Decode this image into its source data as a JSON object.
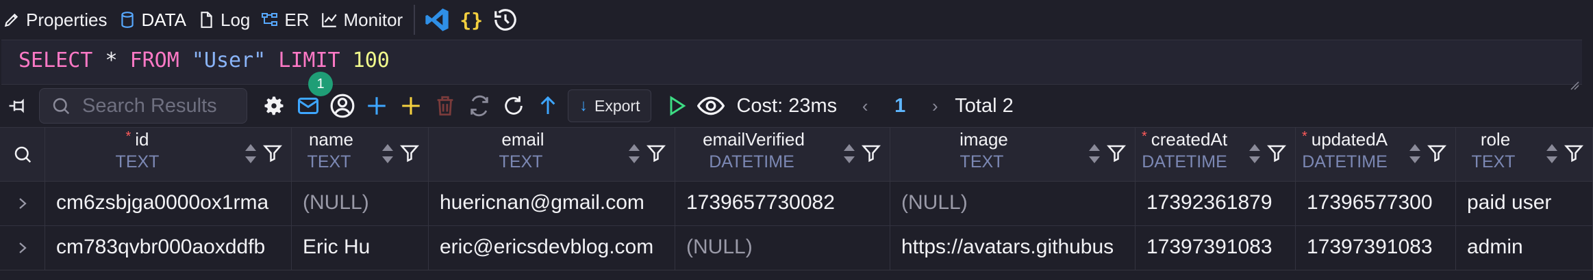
{
  "tabs": [
    {
      "label": "Properties",
      "icon": "pencil-icon"
    },
    {
      "label": "DATA",
      "icon": "database-icon",
      "active": true
    },
    {
      "label": "Log",
      "icon": "document-icon"
    },
    {
      "label": "ER",
      "icon": "er-diagram-icon"
    },
    {
      "label": "Monitor",
      "icon": "chart-line-icon"
    }
  ],
  "tools": {
    "braces": "{}"
  },
  "editor": {
    "tokens": {
      "kw1": "SELECT",
      "star": "*",
      "kw2": "FROM",
      "table": "\"User\"",
      "kw3": "LIMIT",
      "limit": "100"
    }
  },
  "toolbar": {
    "search_placeholder": "Search Results",
    "mail_badge": "1",
    "export_label": "Export",
    "cost": "Cost: 23ms",
    "page_prev": "‹",
    "page": "1",
    "page_next": "›",
    "total": "Total 2"
  },
  "colors": {
    "accent": "#57a9ff",
    "keyword": "#ff79c6",
    "string": "#8ab4f8",
    "number": "#f1fa8c",
    "required": "#ff5b5b",
    "type": "#7c88b4"
  },
  "columns": [
    {
      "name": "id",
      "type": "TEXT",
      "required": true
    },
    {
      "name": "name",
      "type": "TEXT",
      "required": false
    },
    {
      "name": "email",
      "type": "TEXT",
      "required": false
    },
    {
      "name": "emailVerified",
      "type": "DATETIME",
      "required": false
    },
    {
      "name": "image",
      "type": "TEXT",
      "required": false
    },
    {
      "name": "createdAt",
      "type": "DATETIME",
      "required": true
    },
    {
      "name": "updatedA",
      "type": "DATETIME",
      "required": true
    },
    {
      "name": "role",
      "type": "TEXT",
      "required": false
    }
  ],
  "rows": [
    [
      "cm6zsbjga0000ox1rma",
      "(NULL)",
      "huericnan@gmail.com",
      "1739657730082",
      "(NULL)",
      "17392361879",
      "17396577300",
      "paid user"
    ],
    [
      "cm783qvbr000aoxddfb",
      "Eric Hu",
      "eric@ericsdevblog.com",
      "(NULL)",
      "https://avatars.githubus",
      "17397391083",
      "17397391083",
      "admin"
    ]
  ]
}
